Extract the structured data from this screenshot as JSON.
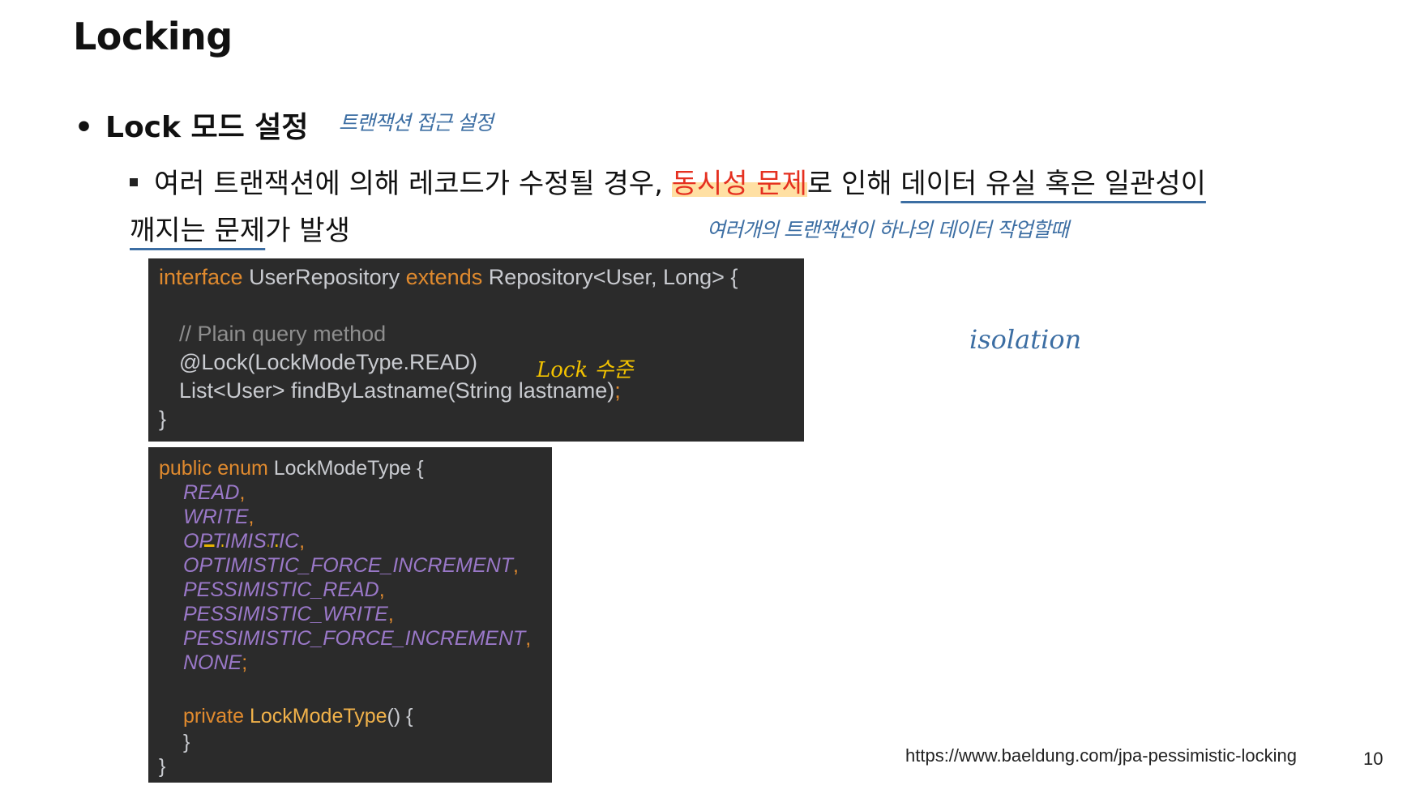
{
  "slide": {
    "title": "Locking",
    "bullet1": "Lock 모드 설정",
    "bullet1_dot": "•",
    "para_part1": "여러 트랜잭션에 의해 레코드가 수정될 경우, ",
    "para_highlight": "동시성 문제",
    "para_part2": "로 인해 ",
    "para_underline1": "데이터 유실 혹은 일관성이",
    "para_underline2": "깨지는 문제",
    "para_part3": "가 발생",
    "source_url": "https://www.baeldung.com/jpa-pessimistic-locking",
    "page_number": "10"
  },
  "handwriting": {
    "note_access": "트랜잭션 접근 설정",
    "note_multi": "여러개의 트랜잭션이 하나의 데이터 작업할때",
    "note_lock_level": "Lock 수준",
    "note_isolation": "isolation"
  },
  "code1": {
    "kw_interface": "interface",
    "name": " UserRepository ",
    "kw_extends": "extends",
    "rest": " Repository<User, Long> {",
    "comment": "// Plain query method",
    "annotation": "@Lock(LockModeType.READ)",
    "method": "List<User> findByLastname(String lastname)",
    "semi": ";",
    "close": "}"
  },
  "code2": {
    "kw_public_enum": "public enum",
    "name": " LockModeType {",
    "values": [
      "READ",
      "WRITE",
      "OPTIMISTIC",
      "OPTIMISTIC_FORCE_INCREMENT",
      "PESSIMISTIC_READ",
      "PESSIMISTIC_WRITE",
      "PESSIMISTIC_FORCE_INCREMENT",
      "NONE"
    ],
    "sep_comma": ",",
    "sep_semi": ";",
    "kw_private": "private",
    "ctor": "LockModeType",
    "ctor_rest": "() {",
    "inner_close": "}",
    "close": "}"
  },
  "colors": {
    "keyword": "#e08a2e",
    "enum_value": "#9a78c8",
    "highlight": "#ffe0a3",
    "accent_red": "#e53020",
    "ink_blue": "#3c6ea3",
    "ink_yellow": "#f2c200"
  }
}
